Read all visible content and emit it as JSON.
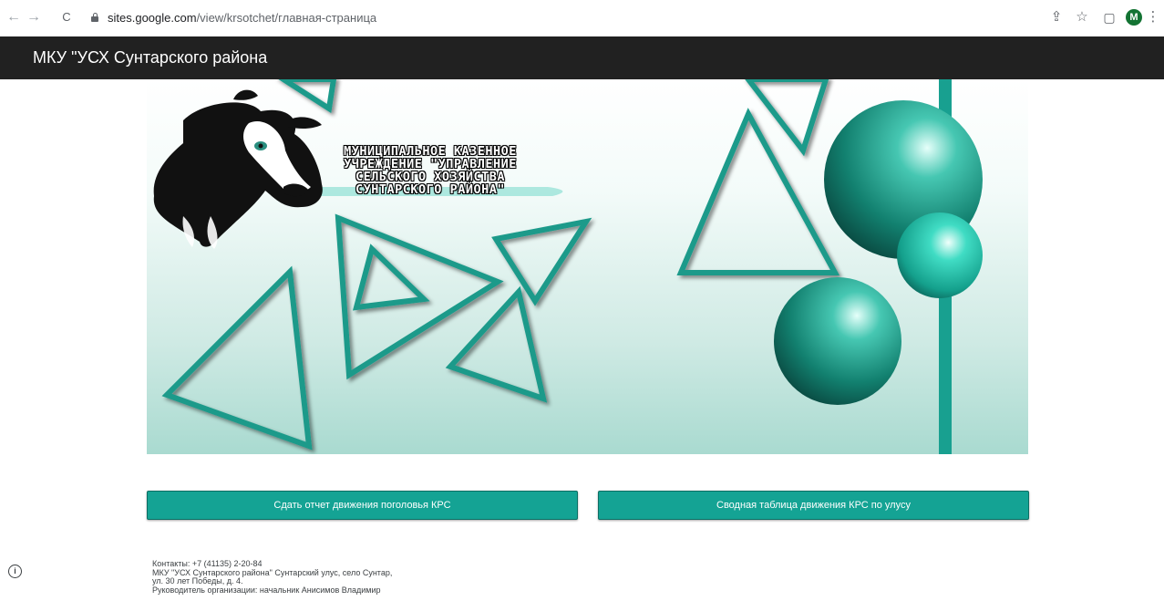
{
  "browser": {
    "back_icon": "←",
    "forward_icon": "→",
    "reload_icon": "C",
    "url_host": "sites.google.com",
    "url_path": "/view/krsotchet/главная-страница",
    "share_icon": "⇪",
    "star_icon": "☆",
    "sidepanel_icon": "▢",
    "avatar_letter": "M",
    "menu_icon": "⋮"
  },
  "site": {
    "title": "МКУ \"УСХ Сунтарского района"
  },
  "banner": {
    "lines": [
      "МУНИЦИПАЛЬНОЕ КАЗЕННОЕ",
      "УЧРЕЖДЕНИЕ \"УПРАВЛЕНИЕ",
      "СЕЛЬСКОГО ХОЗЯЙСТВА",
      "СУНТАРСКОГО РАЙОНА\""
    ],
    "accent_color": "#18a090"
  },
  "buttons": {
    "report": "Сдать отчет движения поголовья КРС",
    "summary": "Сводная таблица движения КРС по улусу"
  },
  "footer": {
    "info_icon": "i",
    "lines": [
      "Контакты: +7 (41135) 2-20-84",
      "МКУ \"УСХ Сунтарского района\" Сунтарский улус, село Сунтар,",
      "ул. 30 лет Победы, д. 4.",
      "Руководитель организации: начальник Анисимов Владимир"
    ]
  }
}
